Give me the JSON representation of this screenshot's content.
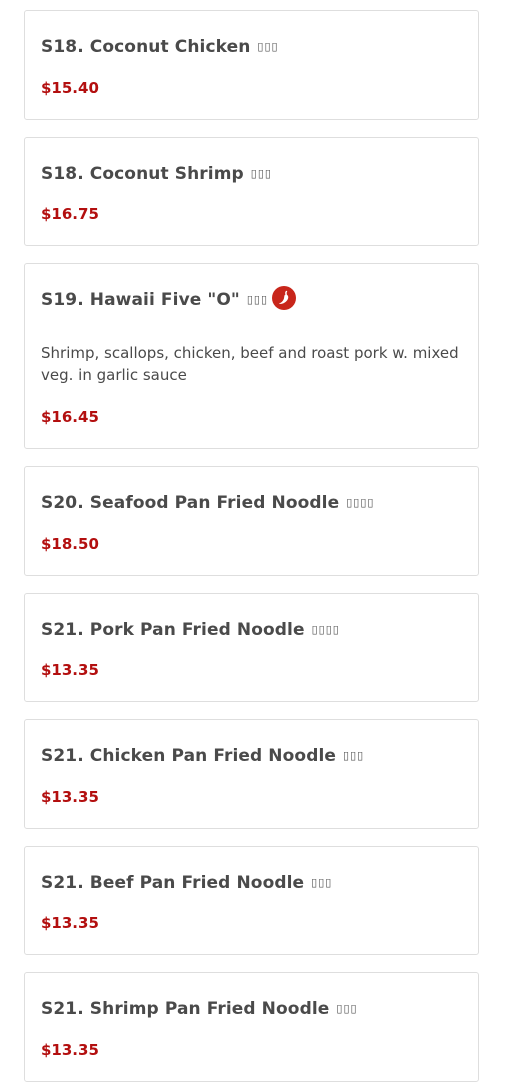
{
  "menu": {
    "items": [
      {
        "name": "S18. Coconut Chicken",
        "cn": "▯▯▯",
        "price": "$15.40",
        "description": "",
        "spicy": false
      },
      {
        "name": "S18. Coconut Shrimp",
        "cn": "▯▯▯",
        "price": "$16.75",
        "description": "",
        "spicy": false
      },
      {
        "name": "S19. Hawaii Five \"O\"",
        "cn": "▯▯▯",
        "price": "$16.45",
        "description": "Shrimp, scallops, chicken, beef and roast pork w. mixed veg. in garlic sauce",
        "spicy": true
      },
      {
        "name": "S20. Seafood Pan Fried Noodle",
        "cn": "▯▯▯▯",
        "price": "$18.50",
        "description": "",
        "spicy": false
      },
      {
        "name": "S21. Pork Pan Fried Noodle",
        "cn": "▯▯▯▯",
        "price": "$13.35",
        "description": "",
        "spicy": false
      },
      {
        "name": "S21. Chicken Pan Fried Noodle",
        "cn": "▯▯▯",
        "price": "$13.35",
        "description": "",
        "spicy": false
      },
      {
        "name": "S21. Beef Pan Fried Noodle",
        "cn": "▯▯▯",
        "price": "$13.35",
        "description": "",
        "spicy": false
      },
      {
        "name": "S21. Shrimp Pan Fried Noodle",
        "cn": "▯▯▯",
        "price": "$13.35",
        "description": "",
        "spicy": false
      }
    ],
    "spicy_icon": "chili-pepper-icon",
    "colors": {
      "price": "#b30f0f",
      "spicy_badge": "#c8261b",
      "card_border": "#dedede",
      "text": "#4a4a4a"
    }
  }
}
